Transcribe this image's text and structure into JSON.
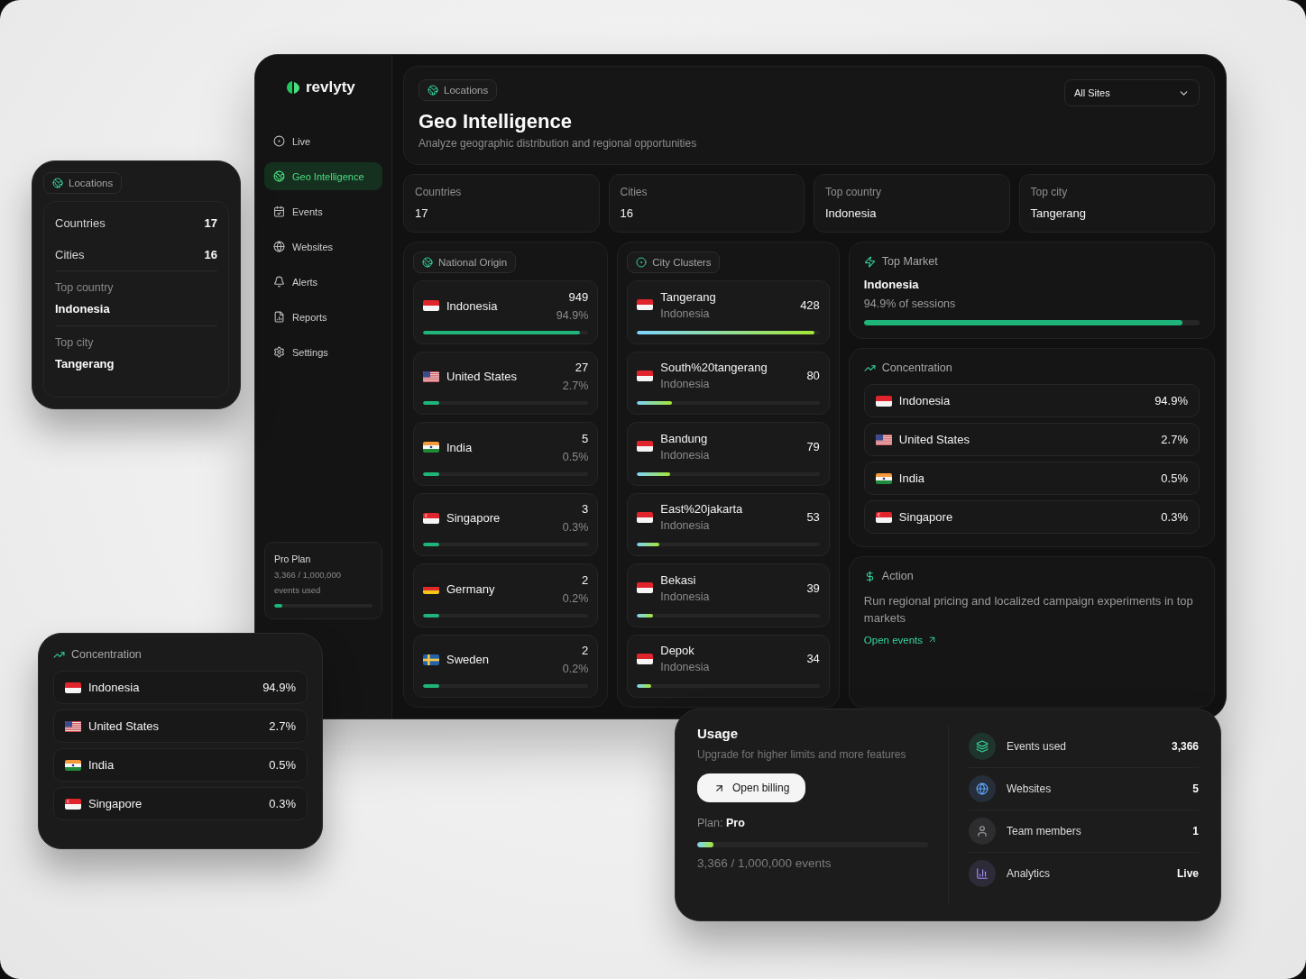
{
  "locations_card": {
    "badge": "Locations",
    "stats": [
      {
        "label": "Countries",
        "value": "17"
      },
      {
        "label": "Cities",
        "value": "16"
      }
    ],
    "highlights": [
      {
        "label": "Top country",
        "value": "Indonesia"
      },
      {
        "label": "Top city",
        "value": "Tangerang"
      }
    ]
  },
  "dashboard": {
    "sidebar": {
      "logo": "revlyty",
      "items": [
        {
          "label": "Live",
          "selected": false
        },
        {
          "label": "Geo Intelligence",
          "selected": true
        },
        {
          "label": "Events",
          "selected": false
        },
        {
          "label": "Websites",
          "selected": false
        },
        {
          "label": "Alerts",
          "selected": false
        },
        {
          "label": "Reports",
          "selected": false
        },
        {
          "label": "Settings",
          "selected": false
        }
      ],
      "plan": {
        "title": "Pro Plan",
        "usage": "3,366 / 1,000,000",
        "caption": "events used",
        "level": 0.08
      }
    },
    "header": {
      "badge": "Locations",
      "title": "Geo Intelligence",
      "subtitle": "Analyze geographic distribution and regional opportunities"
    },
    "site_select": {
      "value": "All Sites"
    },
    "stats": [
      {
        "label": "Countries",
        "value": "17"
      },
      {
        "label": "Cities",
        "value": "16"
      },
      {
        "label": "Top country",
        "value": "Indonesia"
      },
      {
        "label": "Top city",
        "value": "Tangerang"
      }
    ],
    "national_origin": {
      "title": "National Origin",
      "rows": [
        {
          "kind": "indonesia",
          "country": "Indonesia",
          "count": "949",
          "share": "94.9%",
          "level": 0.95
        },
        {
          "kind": "usa",
          "country": "United States",
          "count": "27",
          "share": "2.7%",
          "level": 0.1
        },
        {
          "kind": "india",
          "country": "India",
          "count": "5",
          "share": "0.5%",
          "level": 0.1
        },
        {
          "kind": "singapore",
          "country": "Singapore",
          "count": "3",
          "share": "0.3%",
          "level": 0.1
        },
        {
          "kind": "germany",
          "country": "Germany",
          "count": "2",
          "share": "0.2%",
          "level": 0.1
        },
        {
          "kind": "sweden",
          "country": "Sweden",
          "count": "2",
          "share": "0.2%",
          "level": 0.1
        }
      ]
    },
    "city_clusters": {
      "title": "City Clusters",
      "rows": [
        {
          "kind": "indonesia",
          "city": "Tangerang",
          "country": "Indonesia",
          "count": "428",
          "level": 0.97
        },
        {
          "kind": "indonesia",
          "city": "South%20tangerang",
          "country": "Indonesia",
          "count": "80",
          "level": 0.19
        },
        {
          "kind": "indonesia",
          "city": "Bandung",
          "country": "Indonesia",
          "count": "79",
          "level": 0.18
        },
        {
          "kind": "indonesia",
          "city": "East%20jakarta",
          "country": "Indonesia",
          "count": "53",
          "level": 0.12
        },
        {
          "kind": "indonesia",
          "city": "Bekasi",
          "country": "Indonesia",
          "count": "39",
          "level": 0.09
        },
        {
          "kind": "indonesia",
          "city": "Depok",
          "country": "Indonesia",
          "count": "34",
          "level": 0.08
        }
      ]
    },
    "top_market": {
      "title": "Top Market",
      "country": "Indonesia",
      "caption": "94.9% of sessions",
      "level": 0.949
    },
    "concentration": {
      "title": "Concentration",
      "rows": [
        {
          "kind": "indonesia",
          "country": "Indonesia",
          "share": "94.9%"
        },
        {
          "kind": "usa",
          "country": "United States",
          "share": "2.7%"
        },
        {
          "kind": "india",
          "country": "India",
          "share": "0.5%"
        },
        {
          "kind": "singapore",
          "country": "Singapore",
          "share": "0.3%"
        }
      ]
    },
    "action": {
      "title": "Action",
      "text": "Run regional pricing and localized campaign experiments in top markets",
      "link": "Open events"
    }
  },
  "concentration_card": {
    "title": "Concentration",
    "rows": [
      {
        "kind": "indonesia",
        "country": "Indonesia",
        "share": "94.9%"
      },
      {
        "kind": "usa",
        "country": "United States",
        "share": "2.7%"
      },
      {
        "kind": "india",
        "country": "India",
        "share": "0.5%"
      },
      {
        "kind": "singapore",
        "country": "Singapore",
        "share": "0.3%"
      }
    ]
  },
  "usage_card": {
    "title": "Usage",
    "subtitle": "Upgrade for higher limits and more features",
    "button": "Open billing",
    "plan": "Plan: **Pro**",
    "level": 0.07,
    "caption": "3,366 / 1,000,000 events",
    "stats": [
      {
        "label": "Events used",
        "value": "3,366",
        "color": "#34d399"
      },
      {
        "label": "Websites",
        "value": "5",
        "color": "#60a5fa"
      },
      {
        "label": "Team members",
        "value": "1",
        "color": "#a1a1aa"
      },
      {
        "label": "Analytics",
        "value": "Live",
        "color": "#a78bfa"
      }
    ]
  }
}
